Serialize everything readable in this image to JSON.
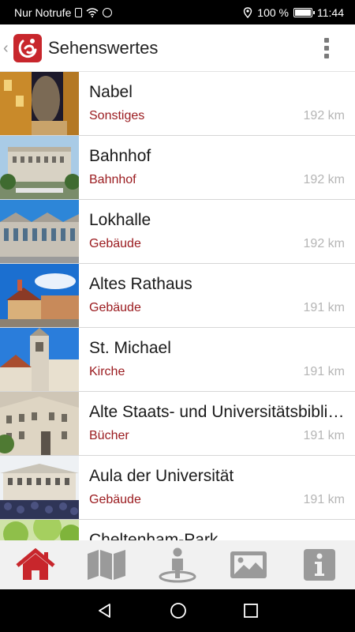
{
  "status_bar": {
    "carrier_text": "Nur Notrufe",
    "battery_text": "100 %",
    "time": "11:44"
  },
  "toolbar": {
    "title": "Sehenswertes"
  },
  "colors": {
    "accent": "#9b1c20",
    "nav_active": "#c8262c",
    "nav_inactive": "#9a9a9a"
  },
  "list": {
    "items": [
      {
        "title": "Nabel",
        "category": "Sonstiges",
        "distance": "192 km"
      },
      {
        "title": "Bahnhof",
        "category": "Bahnhof",
        "distance": "192 km"
      },
      {
        "title": "Lokhalle",
        "category": "Gebäude",
        "distance": "192 km"
      },
      {
        "title": "Altes Rathaus",
        "category": "Gebäude",
        "distance": "191 km"
      },
      {
        "title": "St. Michael",
        "category": "Kirche",
        "distance": "191 km"
      },
      {
        "title": "Alte Staats- und Universitätsbibliothek",
        "category": "Bücher",
        "distance": "191 km"
      },
      {
        "title": "Aula der Universität",
        "category": "Gebäude",
        "distance": "191 km"
      },
      {
        "title": "Cheltenham-Park",
        "category": "",
        "distance": ""
      }
    ]
  },
  "bottom_nav": [
    {
      "icon": "home-icon",
      "active": true
    },
    {
      "icon": "map-icon",
      "active": false
    },
    {
      "icon": "location-person-icon",
      "active": false
    },
    {
      "icon": "gallery-icon",
      "active": false
    },
    {
      "icon": "info-icon",
      "active": false
    }
  ]
}
